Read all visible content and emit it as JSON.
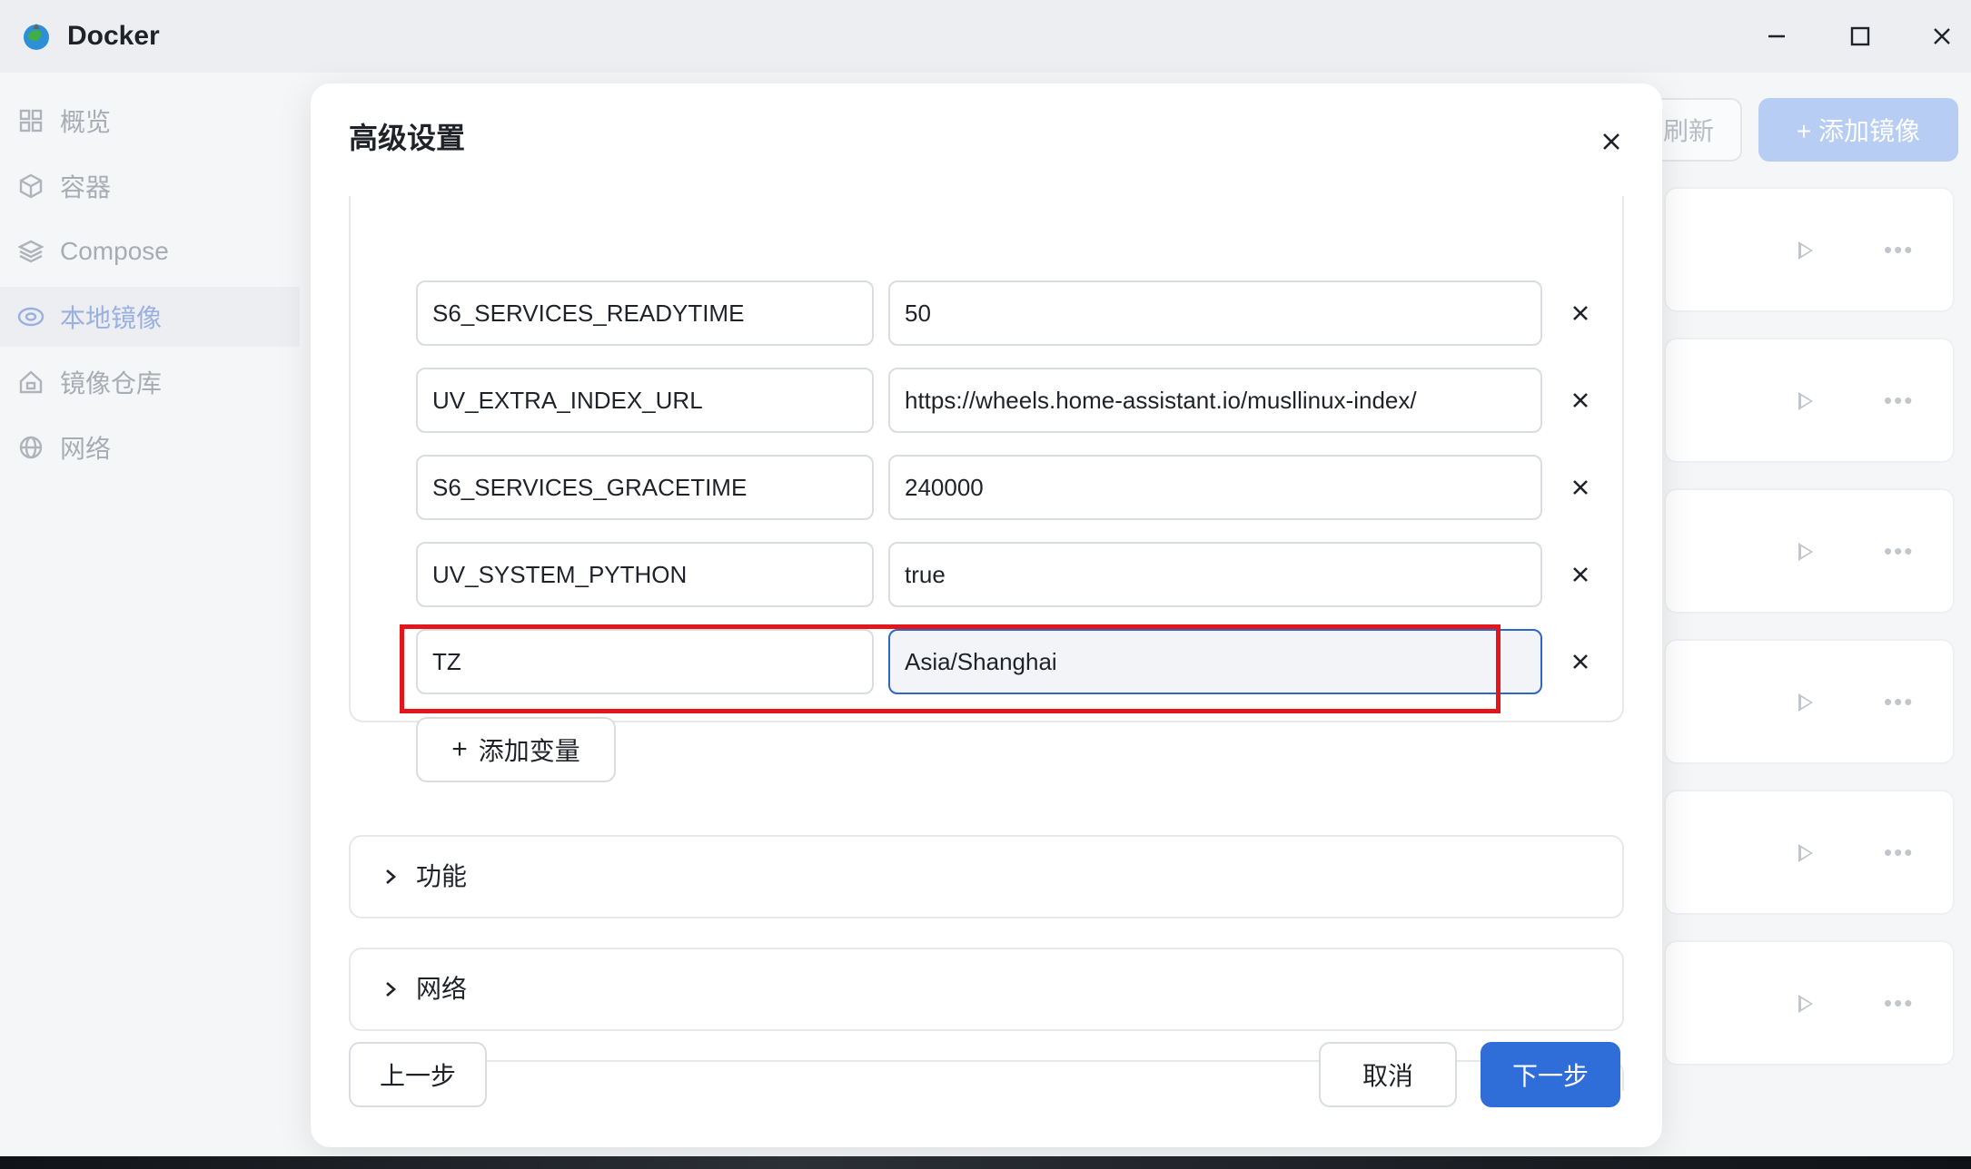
{
  "window": {
    "title": "Docker"
  },
  "sidebar": {
    "items": [
      {
        "label": "概览",
        "icon": "grid-icon"
      },
      {
        "label": "容器",
        "icon": "cube-icon"
      },
      {
        "label": "Compose",
        "icon": "layers-icon"
      },
      {
        "label": "本地镜像",
        "icon": "disc-icon",
        "active": true
      },
      {
        "label": "镜像仓库",
        "icon": "home-icon"
      },
      {
        "label": "网络",
        "icon": "globe-icon"
      }
    ]
  },
  "toolbar": {
    "refresh_label": "刷新",
    "add_image_label": "+ 添加镜像"
  },
  "dialog": {
    "title": "高级设置",
    "env_vars": [
      {
        "key": "S6_SERVICES_READYTIME",
        "value": "50"
      },
      {
        "key": "UV_EXTRA_INDEX_URL",
        "value": "https://wheels.home-assistant.io/musllinux-index/"
      },
      {
        "key": "S6_SERVICES_GRACETIME",
        "value": "240000"
      },
      {
        "key": "UV_SYSTEM_PYTHON",
        "value": "true"
      },
      {
        "key": "TZ",
        "value": "Asia/Shanghai"
      }
    ],
    "add_variable_label": "添加变量",
    "sections": [
      {
        "label": "功能"
      },
      {
        "label": "网络"
      }
    ],
    "footer": {
      "prev_label": "上一步",
      "cancel_label": "取消",
      "next_label": "下一步"
    }
  },
  "colors": {
    "primary": "#2f6ed9",
    "highlight": "#e3161b",
    "focus_border": "#2f66c8"
  }
}
